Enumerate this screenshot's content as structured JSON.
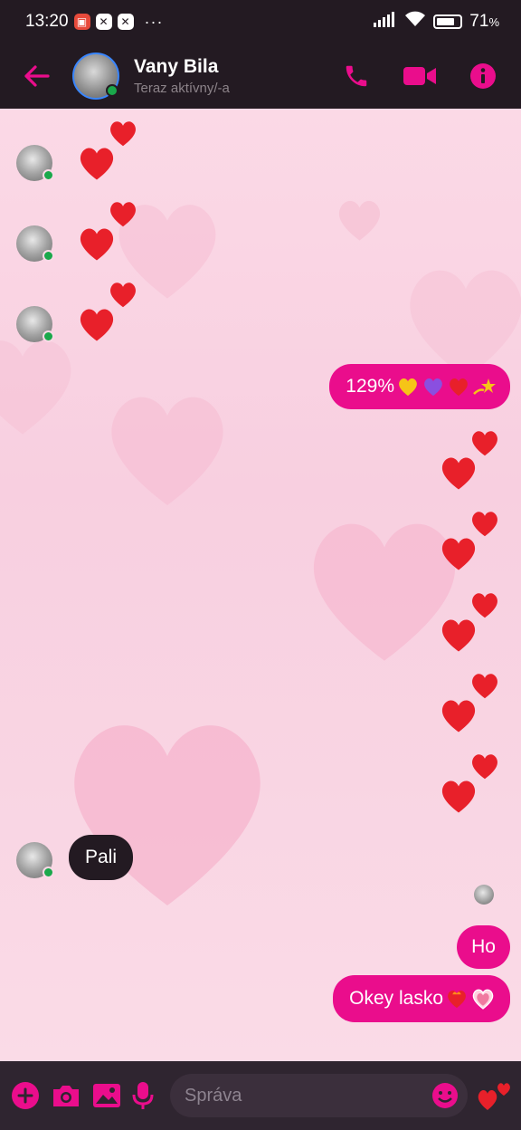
{
  "status_bar": {
    "time": "13:20",
    "more": "···",
    "battery_percent": "71",
    "battery_symbol": "%"
  },
  "header": {
    "contact_name": "Vany Bila",
    "contact_status": "Teraz aktívny/-a"
  },
  "messages": [
    {
      "side": "in",
      "type": "hearts"
    },
    {
      "side": "in",
      "type": "hearts"
    },
    {
      "side": "in",
      "type": "hearts"
    },
    {
      "side": "out",
      "type": "text",
      "text": "129%",
      "emoji_icons": [
        "yellow-heart-icon",
        "purple-heart-icon",
        "red-heart-icon",
        "dizzy-star-icon"
      ]
    },
    {
      "side": "out",
      "type": "hearts"
    },
    {
      "side": "out",
      "type": "hearts"
    },
    {
      "side": "out",
      "type": "hearts"
    },
    {
      "side": "out",
      "type": "hearts"
    },
    {
      "side": "out",
      "type": "hearts"
    },
    {
      "side": "in",
      "type": "text",
      "text": "Pali"
    },
    {
      "side": "out",
      "type": "text",
      "text": "Ho"
    },
    {
      "side": "out",
      "type": "text",
      "text": "Okey lasko",
      "emoji_icons": [
        "heart-on-fire-icon",
        "heart-with-ribbon-icon"
      ]
    }
  ],
  "composer": {
    "placeholder": "Správa"
  },
  "colors": {
    "accent": "#ea0d8c",
    "header_bg": "#231a22",
    "chat_bg": "#f9d3e2",
    "online": "#1aa84b"
  }
}
